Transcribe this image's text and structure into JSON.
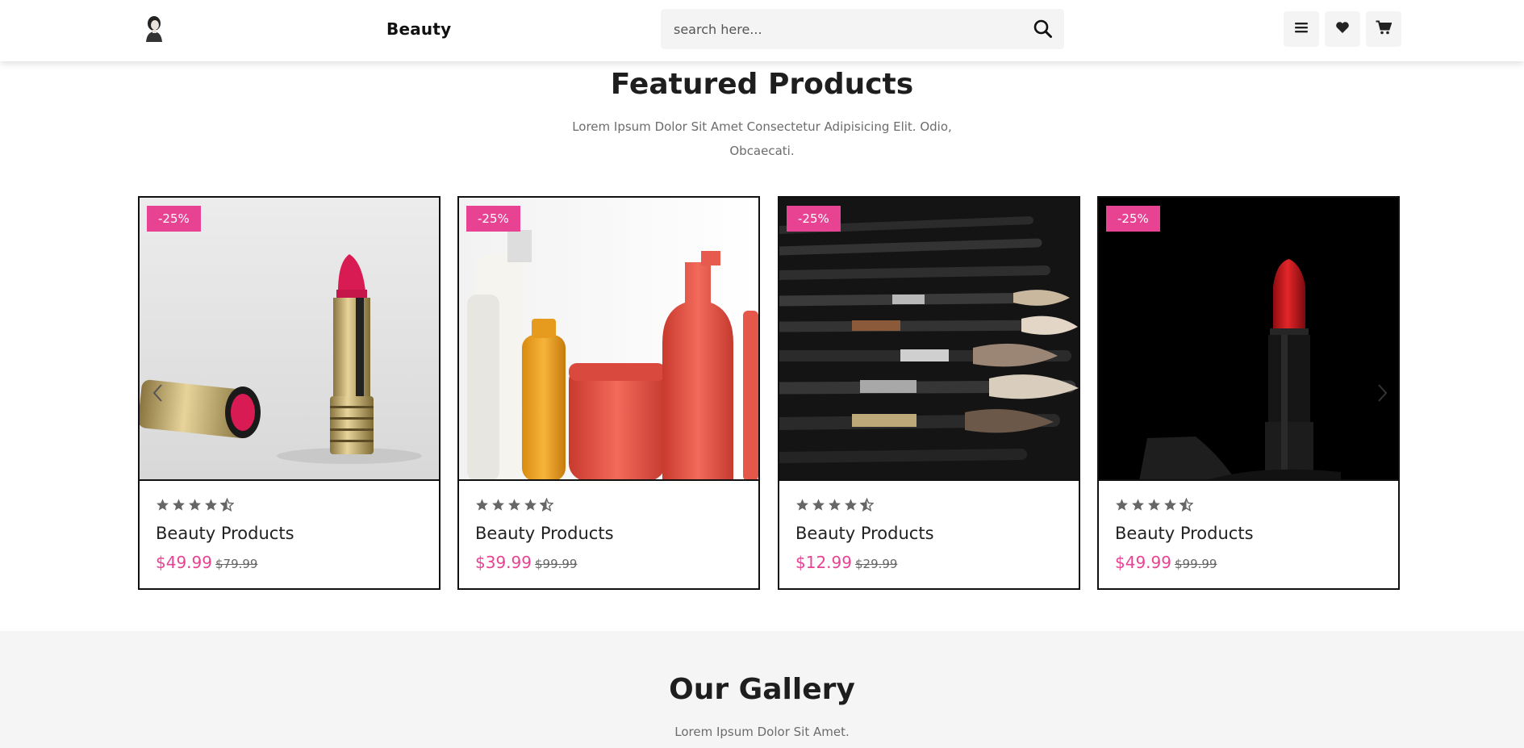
{
  "header": {
    "brand": "Beauty",
    "search_placeholder": "search here...",
    "icons": [
      "menu-icon",
      "heart-icon",
      "cart-icon",
      "search-icon"
    ]
  },
  "featured": {
    "title": "Featured Products",
    "description_line1": "Lorem Ipsum Dolor Sit Amet Consectetur Adipisicing Elit. Odio,",
    "description_line2": "Obcaecati.",
    "products": [
      {
        "badge": "-25%",
        "name": "Beauty Products",
        "price": "$49.99",
        "old_price": "$79.99",
        "rating": 4.5
      },
      {
        "badge": "-25%",
        "name": "Beauty Products",
        "price": "$39.99",
        "old_price": "$99.99",
        "rating": 4.5
      },
      {
        "badge": "-25%",
        "name": "Beauty Products",
        "price": "$12.99",
        "old_price": "$29.99",
        "rating": 4.5
      },
      {
        "badge": "-25%",
        "name": "Beauty Products",
        "price": "$49.99",
        "old_price": "$99.99",
        "rating": 4.5
      }
    ]
  },
  "gallery": {
    "title": "Our Gallery",
    "description": "Lorem Ipsum Dolor Sit Amet."
  },
  "colors": {
    "accent": "#e84393",
    "dark": "#1e1e1e",
    "muted": "#6c6c6c",
    "light_bg": "#f5f5f5"
  }
}
